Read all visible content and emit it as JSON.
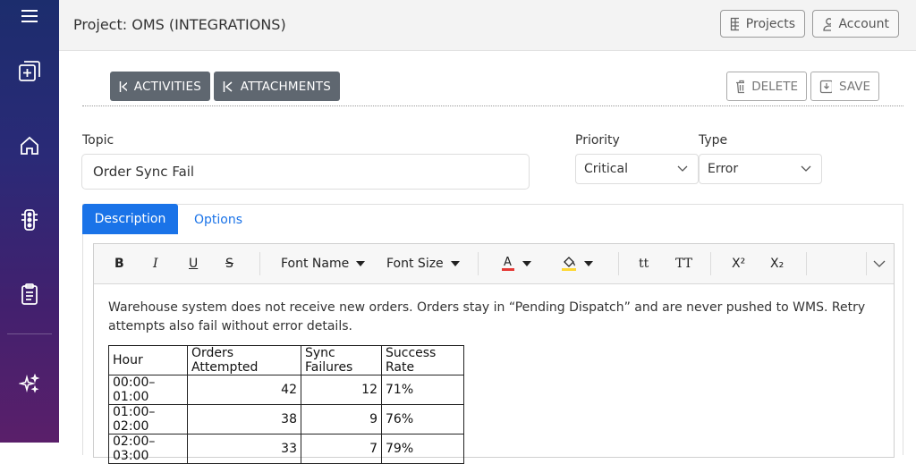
{
  "header": {
    "project_title": "Project: OMS (INTEGRATIONS)",
    "projects_label": "Projects",
    "account_label": "Account"
  },
  "sidebar": {
    "icons": [
      "menu-icon",
      "add-icon",
      "home-icon",
      "traffic-light-icon",
      "clipboard-icon",
      "sparkle-icon"
    ]
  },
  "actions": {
    "activities_label": "ACTIVITIES",
    "attachments_label": "ATTACHMENTS",
    "delete_label": "DELETE",
    "save_label": "SAVE"
  },
  "form": {
    "topic_label": "Topic",
    "topic_value": "Order Sync Fail",
    "priority_label": "Priority",
    "priority_value": "Critical",
    "type_label": "Type",
    "type_value": "Error"
  },
  "tabs": {
    "description": "Description",
    "options": "Options"
  },
  "toolbar": {
    "bold": "B",
    "italic": "I",
    "underline": "U",
    "strike": "S",
    "font_name": "Font Name",
    "font_size": "Font Size",
    "lowercase": "tt",
    "uppercase": "TT",
    "superscript": "X²",
    "subscript": "X₂"
  },
  "colors": {
    "accent": "#1a73e8",
    "font_color": "#e53935",
    "highlight_color": "#fdd835"
  },
  "content": {
    "paragraph": "Warehouse system does not receive new orders. Orders stay in “Pending Dispatch” and are never pushed to WMS. Retry attempts also fail without error details.",
    "table_headers": [
      "Hour",
      "Orders Attempted",
      "Sync Failures",
      "Success Rate"
    ],
    "table_rows": [
      [
        "00:00–01:00",
        "42",
        "12",
        "71%"
      ],
      [
        "01:00–02:00",
        "38",
        "9",
        "76%"
      ],
      [
        "02:00–03:00",
        "33",
        "7",
        "79%"
      ]
    ]
  }
}
